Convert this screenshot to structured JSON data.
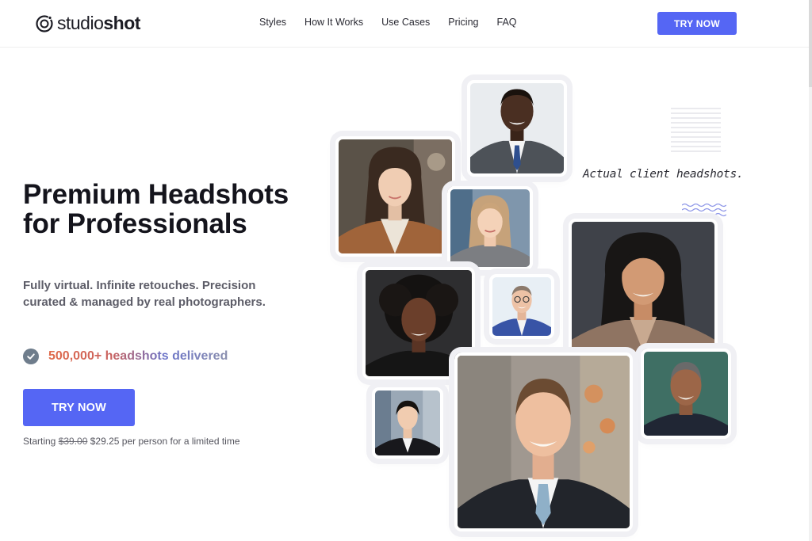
{
  "brand": {
    "prefix": "studio",
    "suffix": "shot",
    "accent": "#5566f4"
  },
  "nav": {
    "items": [
      "Styles",
      "How It Works",
      "Use Cases",
      "Pricing",
      "FAQ"
    ]
  },
  "header": {
    "cta_label": "TRY NOW"
  },
  "hero": {
    "title": "Premium Headshots for Professionals",
    "subtitle": "Fully virtual. Infinite retouches. Precision curated & managed by real photographers.",
    "stat_text": "500,000+ headshots delivered",
    "cta_label": "TRY NOW",
    "price_prefix": "Starting",
    "price_old": "$39.00",
    "price_new": "$29.25 per person for a limited time"
  },
  "gallery": {
    "caption": "Actual client headshots.",
    "photos": [
      "man-grey-suit-blue-tie",
      "woman-brown-coat",
      "woman-blonde-grey-top",
      "woman-dark-curly-hair",
      "man-glasses-blue-blazer",
      "woman-dark-hair-brown-blazer",
      "man-suit-light-blue-tie",
      "man-smiling-teal-background",
      "woman-black-suit-city"
    ]
  }
}
